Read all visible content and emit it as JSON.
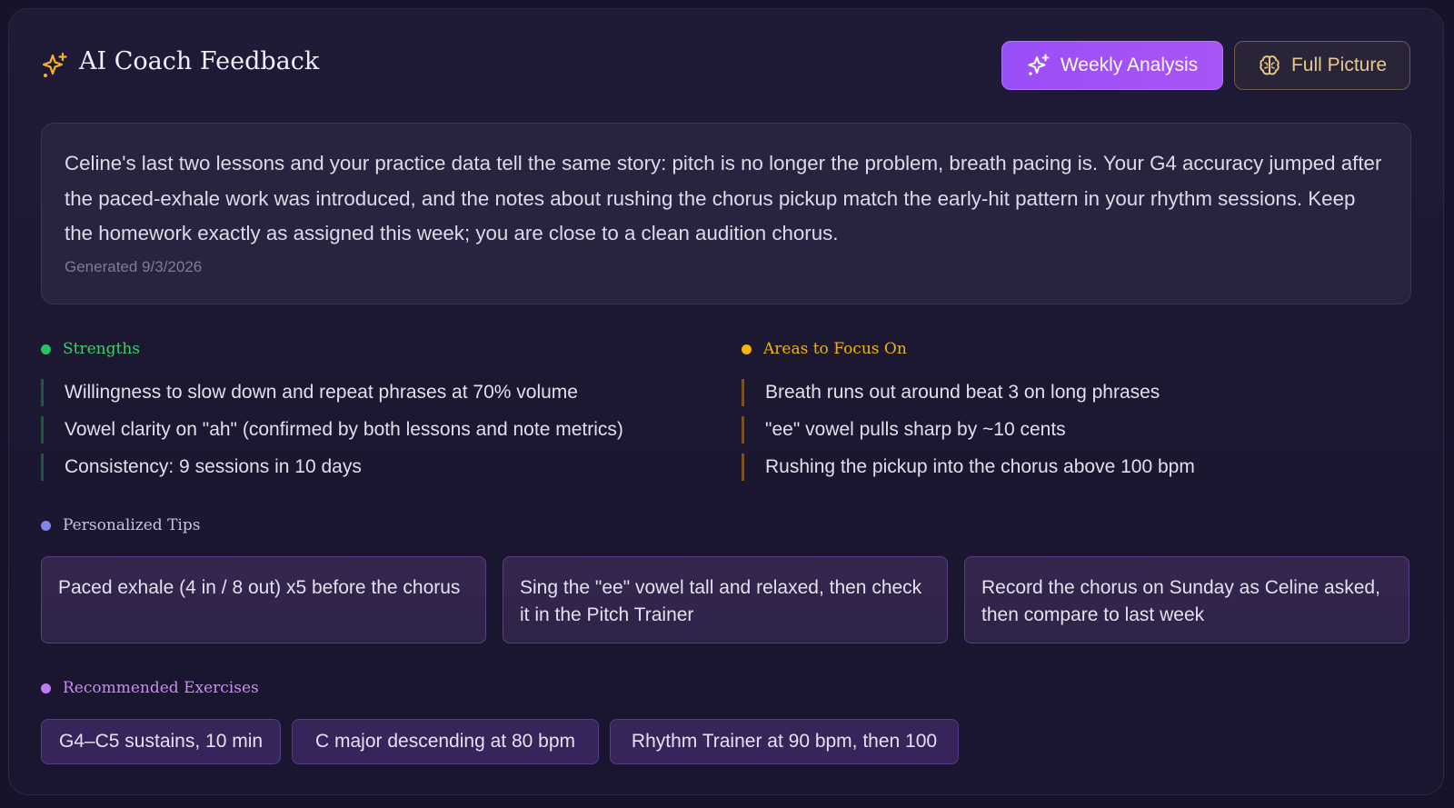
{
  "header": {
    "title": "AI Coach Feedback",
    "icon": "sparkles-icon",
    "weekly_label": "Weekly Analysis",
    "full_label": "Full Picture"
  },
  "summary": {
    "text": "Celine's last two lessons and your practice data tell the same story: pitch is no longer the problem, breath pacing is. Your G4 accuracy jumped after the paced-exhale work was introduced, and the notes about rushing the chorus pickup match the early-hit pattern in your rhythm sessions. Keep the homework exactly as assigned this week; you are close to a clean audition chorus.",
    "generated": "Generated 9/3/2026"
  },
  "strengths": {
    "title": "Strengths",
    "color": "#22c55e",
    "items": [
      "Willingness to slow down and repeat phrases at 70% volume",
      "Vowel clarity on \"ah\" (confirmed by both lessons and note metrics)",
      "Consistency: 9 sessions in 10 days"
    ]
  },
  "focus": {
    "title": "Areas to Focus On",
    "color": "#f5b50a",
    "items": [
      "Breath runs out around beat 3 on long phrases",
      "\"ee\" vowel pulls sharp by ~10 cents",
      "Rushing the pickup into the chorus above 100 bpm"
    ]
  },
  "tips": {
    "title": "Personalized Tips",
    "color": "#7c86f0",
    "items": [
      "Paced exhale (4 in / 8 out) x5 before the chorus",
      "Sing the \"ee\" vowel tall and relaxed, then check it in the Pitch Trainer",
      "Record the chorus on Sunday as Celine asked, then compare to last week"
    ]
  },
  "exercises": {
    "title": "Recommended Exercises",
    "color": "#c07af2",
    "items": [
      "G4–C5 sustains, 10 min",
      "C major descending at 80 bpm",
      "Rhythm Trainer at 90 bpm, then 100"
    ]
  }
}
